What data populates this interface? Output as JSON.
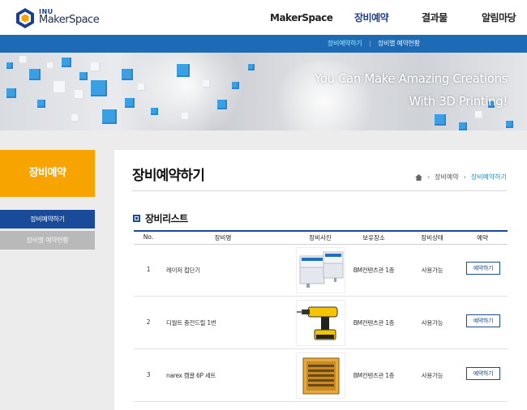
{
  "logo": {
    "small": "INU",
    "name": "MakerSpace",
    "icon": "hexagon-logo-icon"
  },
  "nav": {
    "items": [
      {
        "label": "MakerSpace",
        "active": false
      },
      {
        "label": "장비예약",
        "active": true
      },
      {
        "label": "결과물",
        "active": false
      },
      {
        "label": "알림마당",
        "active": false
      }
    ]
  },
  "subnav": {
    "items": [
      "장비예약하기",
      "장비별 예약현황"
    ],
    "active_index": 0
  },
  "banner": {
    "line1": "You Can Make Amazing Creations",
    "line2": "With 3D Printing!"
  },
  "sidebar": {
    "title": "장비예약",
    "items": [
      {
        "label": "장비예약하기",
        "active": true
      },
      {
        "label": "장비별 예약현황",
        "active": false
      }
    ]
  },
  "page": {
    "title": "장비예약하기",
    "breadcrumb": [
      "장비예약",
      "장비예약하기"
    ],
    "list_title": "장비리스트"
  },
  "table": {
    "headers": [
      "No.",
      "장비명",
      "장비사진",
      "보유장소",
      "장비상태",
      "예약"
    ],
    "rows": [
      {
        "no": "1",
        "name": "레이저 접단기",
        "photo": "laser-cutter",
        "location": "BM컨텐츠관 1층",
        "status": "사용가능",
        "action": "예약하기"
      },
      {
        "no": "2",
        "name": "디월트 충전드릴 1번",
        "photo": "cordless-drill",
        "location": "BM컨텐츠관 1층",
        "status": "사용가능",
        "action": "예약하기"
      },
      {
        "no": "3",
        "name": "narex 켐끌 6P 세트",
        "photo": "chisel-set",
        "location": "BM컨텐츠관 1층",
        "status": "사용가능",
        "action": "예약하기"
      }
    ]
  },
  "colors": {
    "primary": "#1a4b9b",
    "accent": "#f7a400",
    "subnav": "#1e6bb5",
    "crumb_current": "#2a8fd0"
  }
}
